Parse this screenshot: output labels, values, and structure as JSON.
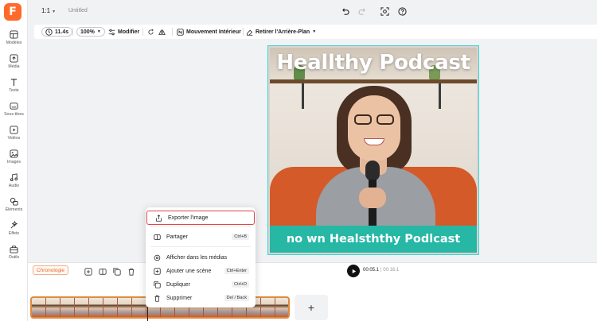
{
  "app": {
    "logo_letter": "F",
    "accent": "#ff6a2b",
    "ratio": "1:1",
    "doc_title": "Untitled"
  },
  "sidebar": {
    "items": [
      {
        "label": "Modèles",
        "icon": "layout-icon"
      },
      {
        "label": "Média",
        "icon": "media-upload-icon"
      },
      {
        "label": "Texte",
        "icon": "text-icon"
      },
      {
        "label": "Sous-titres",
        "icon": "subtitles-icon"
      },
      {
        "label": "Vidéos",
        "icon": "video-icon"
      },
      {
        "label": "Images",
        "icon": "image-icon"
      },
      {
        "label": "Audio",
        "icon": "music-icon"
      },
      {
        "label": "Éléments",
        "icon": "elements-icon"
      },
      {
        "label": "Effets",
        "icon": "effects-icon"
      },
      {
        "label": "Outils",
        "icon": "toolbox-icon"
      }
    ]
  },
  "toolbar": {
    "duration": "11.4s",
    "zoom": "100%",
    "modify": "Modifier",
    "motion": "Mouvement Intérieur",
    "remove_bg": "Retirer l'Arrière-Plan"
  },
  "canvas": {
    "headline": "Heallthy Podcast",
    "banner": "no wn Healsththy Podlcast",
    "banner_color": "#26b7a5",
    "selection_color": "#3fd3d3"
  },
  "timeline": {
    "chrono_label": "Chronologie",
    "current_time": "00:05.1",
    "total_time": "| 00:16.1",
    "add_label": "+"
  },
  "context_menu": {
    "items": [
      {
        "label": "Exporter l'image",
        "shortcut": "",
        "icon": "export-image-icon",
        "highlighted": true
      },
      {
        "label": "Partager",
        "shortcut": "Ctrl+B",
        "icon": "share-icon",
        "highlighted": false
      },
      {
        "label": "Afficher dans les médias",
        "shortcut": "",
        "icon": "location-icon",
        "highlighted": false
      },
      {
        "label": "Ajouter une scène",
        "shortcut": "Ctrl+Enter",
        "icon": "add-scene-icon",
        "highlighted": false
      },
      {
        "label": "Dupliquer",
        "shortcut": "Ctrl+D",
        "icon": "duplicate-icon",
        "highlighted": false
      },
      {
        "label": "Supprimer",
        "shortcut": "Del / Back",
        "icon": "trash-icon",
        "highlighted": false
      }
    ],
    "highlight_color": "#e0464a"
  }
}
